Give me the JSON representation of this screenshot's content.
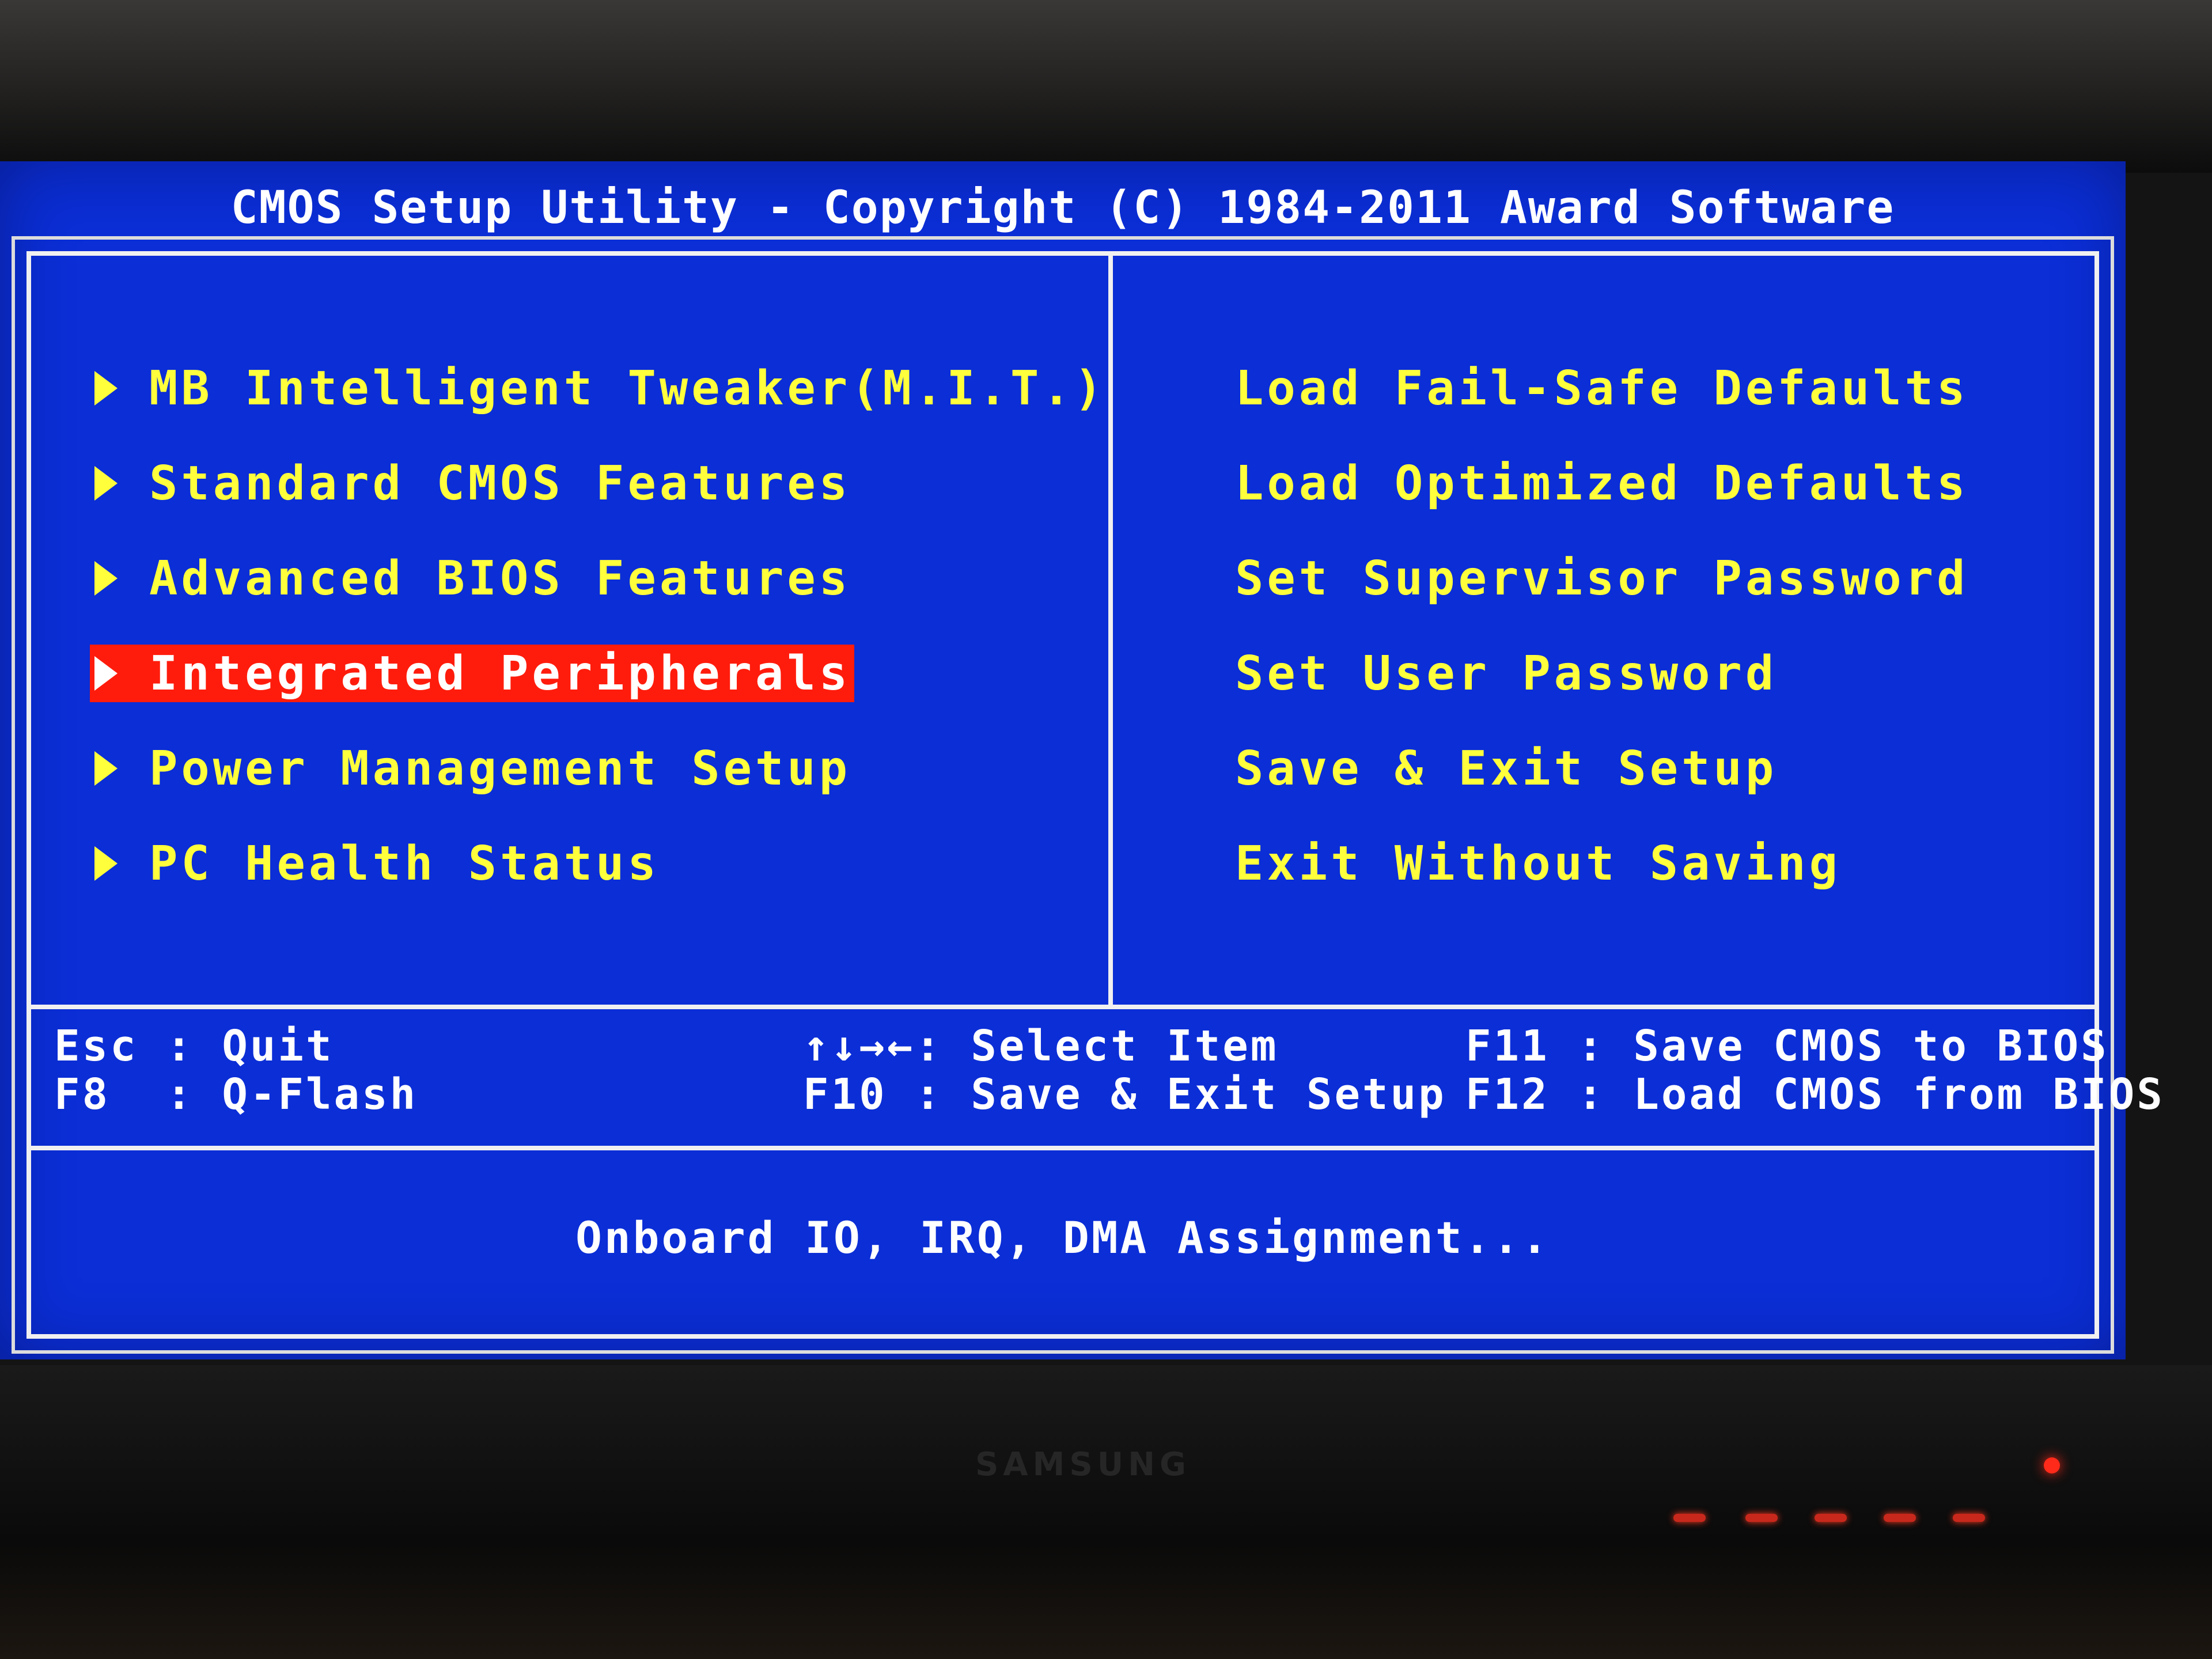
{
  "title": "CMOS Setup Utility - Copyright (C) 1984-2011 Award Software",
  "left_menu": [
    {
      "label": "MB Intelligent Tweaker(M.I.T.)",
      "selected": false
    },
    {
      "label": "Standard CMOS Features",
      "selected": false
    },
    {
      "label": "Advanced BIOS Features",
      "selected": false
    },
    {
      "label": "Integrated Peripherals",
      "selected": true
    },
    {
      "label": "Power Management Setup",
      "selected": false
    },
    {
      "label": "PC Health Status",
      "selected": false
    }
  ],
  "right_menu": [
    {
      "label": "Load Fail-Safe Defaults"
    },
    {
      "label": "Load Optimized Defaults"
    },
    {
      "label": "Set Supervisor Password"
    },
    {
      "label": "Set User Password"
    },
    {
      "label": "Save & Exit Setup"
    },
    {
      "label": "Exit Without Saving"
    }
  ],
  "keys": {
    "esc_key": "Esc",
    "esc_desc": "Quit",
    "f8_key": "F8",
    "f8_desc": "Q-Flash",
    "arrows_key": "↑↓→←",
    "arrows_desc": "Select Item",
    "f10_key": "F10",
    "f10_desc": "Save & Exit Setup",
    "f11_key": "F11",
    "f11_desc": "Save CMOS to BIOS",
    "f12_key": "F12",
    "f12_desc": "Load CMOS from BIOS"
  },
  "help_text": "Onboard IO, IRQ, DMA Assignment...",
  "monitor_brand": "SAMSUNG",
  "colors": {
    "background": "#0b2ed6",
    "menu_text": "#ffff3c",
    "highlight": "#ff1c0c",
    "text": "#ffffff"
  }
}
